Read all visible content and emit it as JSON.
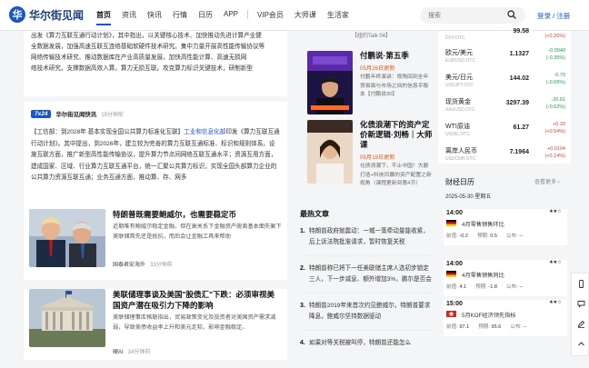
{
  "header": {
    "logo_text": "华尔街见闻",
    "nav": [
      {
        "label": "首页",
        "active": true
      },
      {
        "label": "资讯"
      },
      {
        "label": "快讯"
      },
      {
        "label": "行情"
      },
      {
        "label": "日历"
      },
      {
        "label": "APP"
      },
      {
        "label": "VIP会员"
      },
      {
        "label": "大师课"
      },
      {
        "label": "生活家"
      }
    ],
    "search_placeholder": "搜索",
    "login_label": "登录 / 注册"
  },
  "top_card": {
    "lines": [
      "出发《算力互联互通行动计划》，其中指出，以关键核心技术、加快推动先进计算产业健",
      "全数据发展，加强高速互联互连络基础软硬件技术研究。集中力量开展高性能传输协议等",
      "网络传输技术研究、推动数据库在产业高质量发展，加快高性能计算、高速无损网",
      "络技术研究，支撑数据高效入算，算力无损互联。攻克算力标识关键技术，研制新型"
    ]
  },
  "flash": {
    "tag": "7x24",
    "source": "华尔街见闻快讯",
    "time": "19分钟前",
    "body_start": "【工信部：到2028年 基本实现全国公共算力标准化互联】",
    "body_link": "工业和信息化部",
    "body_rest": "印发《算力互联互通行动计划》。其中提出，到2026年，建立较为完善的算力互联互通标准、标识和规则体系。设施互联方面，推广新型高性能传输协议，提升算力节点间网络互联互通水平；资源互用方面，建成国家、区域、行业算力互联互通平台，统一汇聚公共算力标识，实现全国头部算力企业的公共算力资源互联互通；业务互通方面，推动算、存、网多"
  },
  "articles": [
    {
      "title": "特朗普既需要鲍威尔，也需要稳定币",
      "summary": "近期唯有鲍威尔稳定金融，但在高关系下金融资产脱离基本面失衡下美联储首先还是抵抗，而后会让金融工具来帮助",
      "source": "国泰君安海外",
      "time": "33分钟前"
    },
    {
      "title": "美联储理事谈及美国\"股债汇\"下跌：必须审视美国资产潜在吸引力下降的影响",
      "summary": "美联储理事库格勒指出，贸易政策变化及投资者对美国资产需求减弱，导致美债收益率上升和美元走软，影响金融稳定。",
      "source": "硬AI",
      "time": "34分钟前"
    }
  ],
  "middle": {
    "talk_fragment": "【纽约Talk 04】",
    "programs": [
      {
        "title": "付鹏说·第五季",
        "date": "05月26日更新",
        "desc": "付鹏年终演讲：视角回到全年贸易面与市场之间的信息平衡本【付鹏说30】"
      },
      {
        "title": "化债浪潮下的资产定价新逻辑·刘畅｜大师课",
        "date": "05月19日更新",
        "desc": "化债浪潮下，不止中国！大额打造+科技风暴的资产配置之新视角（课程更新到第4节）"
      }
    ],
    "hot_title": "最热文章",
    "hot": [
      {
        "num": "1.",
        "text": "特朗普政府抛震动：一城一策牵动量能收紧，后上诉法院批准请求，暂时恢复关税"
      },
      {
        "num": "2.",
        "text": "特朗普称已将下一任美联储主席人选初步锁定三人，下一步减息、额外增加3%，鹏尔是否会"
      },
      {
        "num": "3.",
        "text": "特朗普2019年来首次约见鲍威尔，特朗普要求降息，鲍威尔坚持数据驱动"
      },
      {
        "num": "4.",
        "text": "如果对等关税被叫停，特朗普还能怎么"
      }
    ]
  },
  "quotes": [
    {
      "name": "",
      "code": "DXY.OTC",
      "value": "99.58",
      "chg": "",
      "pct": "(+0.26%)",
      "dir": "up"
    },
    {
      "name": "欧元/美元",
      "code": "EURUSD.OTC",
      "value": "1.1327",
      "chg": "-0.0040",
      "pct": "(-0.35%)",
      "dir": "down"
    },
    {
      "name": "美元/日元",
      "code": "USDJPY.OTC",
      "value": "144.02",
      "chg": "-0.79",
      "pct": "(-0.55%)",
      "dir": "down"
    },
    {
      "name": "现货黄金",
      "code": "XAUUSD.OTC",
      "value": "3297.39",
      "chg": "-20.61",
      "pct": "(-0.62%)",
      "dir": "down"
    },
    {
      "name": "WTI原油",
      "code": "USOIL.OTC",
      "value": "61.27",
      "chg": "+0.33",
      "pct": "(+0.54%)",
      "dir": "up"
    },
    {
      "name": "离岸人民币",
      "code": "USDCNH.OTC",
      "value": "7.1964",
      "chg": "+0.0104",
      "pct": "(+0.14%)",
      "dir": "up"
    }
  ],
  "calendar": {
    "title": "财经日历",
    "more": "查看更多 ›",
    "date": "2025-05-30 星期五",
    "items": [
      {
        "time": "14:00",
        "flag": "DE",
        "name": "4月零售销售环比",
        "prev_label": "前值:",
        "prev": "-0.2",
        "fore_label": "预期:",
        "fore": "0.5",
        "act_label": "公布:",
        "act": "--",
        "stars": "★★☆"
      },
      {
        "time": "14:00",
        "flag": "DE",
        "name": "4月零售销售同比",
        "prev_label": "前值:",
        "prev": "4.1",
        "fore_label": "预期:",
        "fore": "-1.8",
        "act_label": "公布:",
        "act": "--",
        "stars": "★★☆"
      },
      {
        "time": "15:00",
        "flag": "CH",
        "name": "5月KOF经济领先指标",
        "prev_label": "前值:",
        "prev": "97.1",
        "fore_label": "预期:",
        "fore": "95.6",
        "act_label": "公布:",
        "act": "--",
        "stars": "★★☆"
      }
    ]
  }
}
